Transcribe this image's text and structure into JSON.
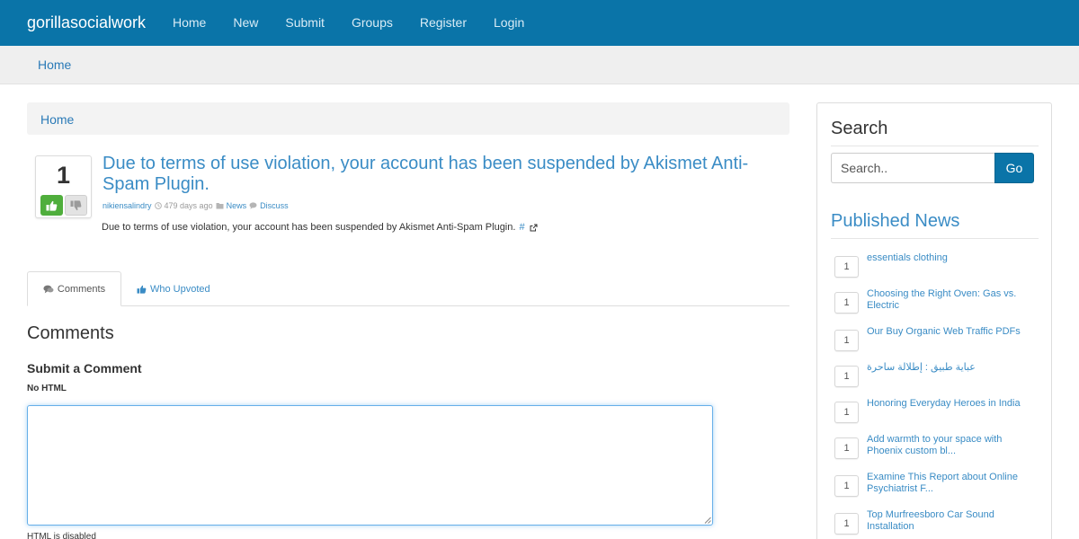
{
  "navbar": {
    "brand": "gorillasocialwork",
    "links": [
      "Home",
      "New",
      "Submit",
      "Groups",
      "Register",
      "Login"
    ]
  },
  "breadcrumb_bar": {
    "home": "Home"
  },
  "inner_breadcrumb": {
    "home": "Home"
  },
  "story": {
    "votes": "1",
    "title": "Due to terms of use violation, your account has been suspended by Akismet Anti-Spam Plugin.",
    "author": "nikiensalindry",
    "age": "479 days ago",
    "category": "News",
    "discuss": "Discuss",
    "description": "Due to terms of use violation, your account has been suspended by Akismet Anti-Spam Plugin.",
    "hash_link": "#"
  },
  "tabs": {
    "comments": "Comments",
    "who_upvoted": "Who Upvoted"
  },
  "comments_section": {
    "heading": "Comments",
    "submit_heading": "Submit a Comment",
    "no_html_label": "No HTML",
    "html_disabled": "HTML is disabled",
    "textarea_value": ""
  },
  "sidebar": {
    "search_title": "Search",
    "search_placeholder": "Search..",
    "go_label": "Go",
    "news_title": "Published News",
    "news": [
      {
        "votes": "1",
        "title": "essentials clothing"
      },
      {
        "votes": "1",
        "title": "Choosing the Right Oven: Gas vs. Electric"
      },
      {
        "votes": "1",
        "title": "Our Buy Organic Web Traffic PDFs"
      },
      {
        "votes": "1",
        "title": "عباية طبيق : إطلالة ساحرة"
      },
      {
        "votes": "1",
        "title": "Honoring Everyday Heroes in India"
      },
      {
        "votes": "1",
        "title": "Add warmth to your space with Phoenix custom bl..."
      },
      {
        "votes": "1",
        "title": "Examine This Report about Online Psychiatrist F..."
      },
      {
        "votes": "1",
        "title": "Top Murfreesboro Car Sound Installation"
      }
    ]
  },
  "colors": {
    "navbar": "#0a74a8",
    "link": "#3a8cc5",
    "upvote": "#4fae3c"
  },
  "icons": {
    "thumbs_up": "thumbs-up-icon",
    "thumbs_down": "thumbs-down-icon",
    "clock": "clock-icon",
    "folder": "folder-icon",
    "comment": "comment-icon",
    "external_link": "external-link-icon"
  }
}
